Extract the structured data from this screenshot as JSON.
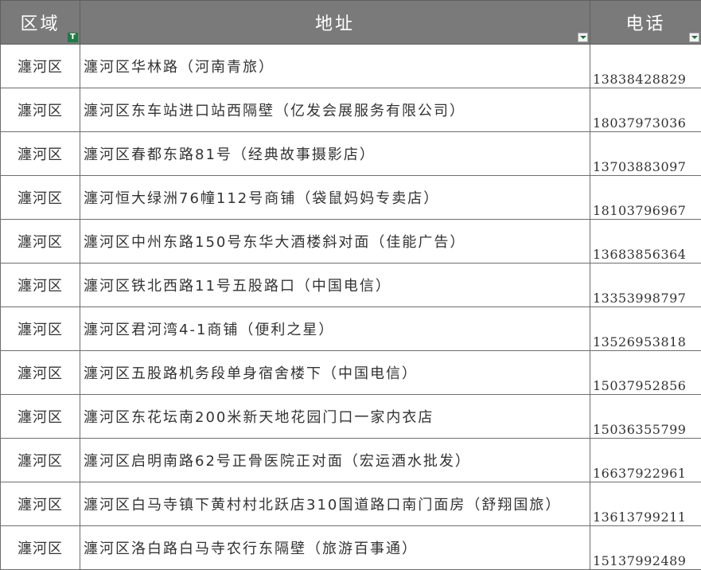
{
  "headers": {
    "area": "区域",
    "address": "地址",
    "phone": "电话"
  },
  "rows": [
    {
      "area": "瀍河区",
      "address": "瀍河区华林路（河南青旅）",
      "phone": "13838428829"
    },
    {
      "area": "瀍河区",
      "address": "瀍河区东车站进口站西隔壁（亿发会展服务有限公司）",
      "phone": "18037973036"
    },
    {
      "area": "瀍河区",
      "address": "瀍河区春都东路81号（经典故事摄影店）",
      "phone": "13703883097"
    },
    {
      "area": "瀍河区",
      "address": "瀍河恒大绿洲76幢112号商铺（袋鼠妈妈专卖店）",
      "phone": "18103796967"
    },
    {
      "area": "瀍河区",
      "address": "瀍河区中州东路150号东华大酒楼斜对面（佳能广告）",
      "phone": "13683856364"
    },
    {
      "area": "瀍河区",
      "address": "瀍河区铁北西路11号五股路口（中国电信）",
      "phone": "13353998797"
    },
    {
      "area": "瀍河区",
      "address": "瀍河区君河湾4-1商铺（便利之星）",
      "phone": "13526953818"
    },
    {
      "area": "瀍河区",
      "address": "瀍河区五股路机务段单身宿舍楼下（中国电信）",
      "phone": "15037952856"
    },
    {
      "area": "瀍河区",
      "address": "瀍河区东花坛南200米新天地花园门口一家内衣店",
      "phone": "15036355799"
    },
    {
      "area": "瀍河区",
      "address": "瀍河区启明南路62号正骨医院正对面（宏运酒水批发）",
      "phone": "16637922961"
    },
    {
      "area": "瀍河区",
      "address": "瀍河区白马寺镇下黄村村北跃店310国道路口南门面房（舒翔国旅）",
      "phone": "13613799211"
    },
    {
      "area": "瀍河区",
      "address": "瀍河区洛白路白马寺农行东隔壁（旅游百事通）",
      "phone": "15137992489"
    }
  ],
  "colors": {
    "header_bg": "#7a7a7a",
    "header_text": "#ffffff",
    "active_filter": "#1e7b46",
    "grid_line": "#6e6e6e"
  },
  "icons": {
    "area_filter": "filter-active-icon",
    "address_filter": "dropdown-arrow-icon",
    "phone_filter": "dropdown-arrow-icon"
  }
}
